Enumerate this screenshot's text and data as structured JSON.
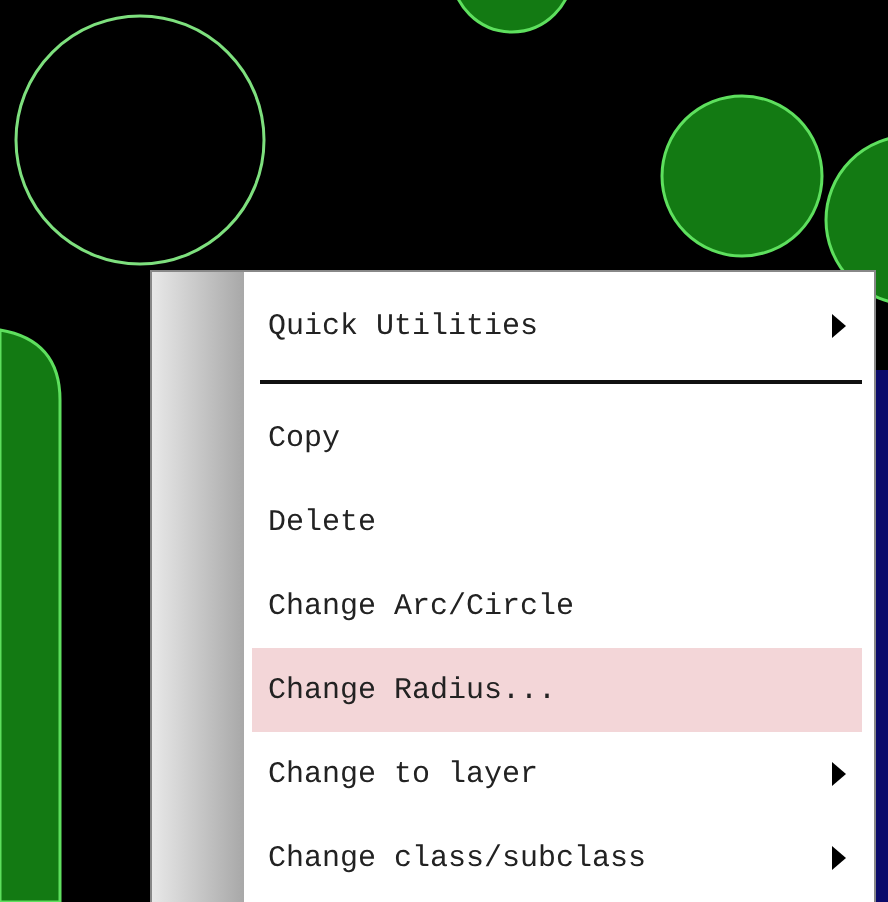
{
  "context_menu": {
    "items": [
      {
        "kind": "submenu",
        "label": "Quick Utilities",
        "selected": false
      },
      {
        "kind": "separator"
      },
      {
        "kind": "command",
        "label": "Copy",
        "selected": false
      },
      {
        "kind": "command",
        "label": "Delete",
        "selected": false
      },
      {
        "kind": "command",
        "label": "Change Arc/Circle",
        "selected": false
      },
      {
        "kind": "command",
        "label": "Change Radius...",
        "selected": true
      },
      {
        "kind": "submenu",
        "label": "Change to layer",
        "selected": false
      },
      {
        "kind": "submenu",
        "label": "Change class/subclass",
        "selected": false
      }
    ]
  }
}
